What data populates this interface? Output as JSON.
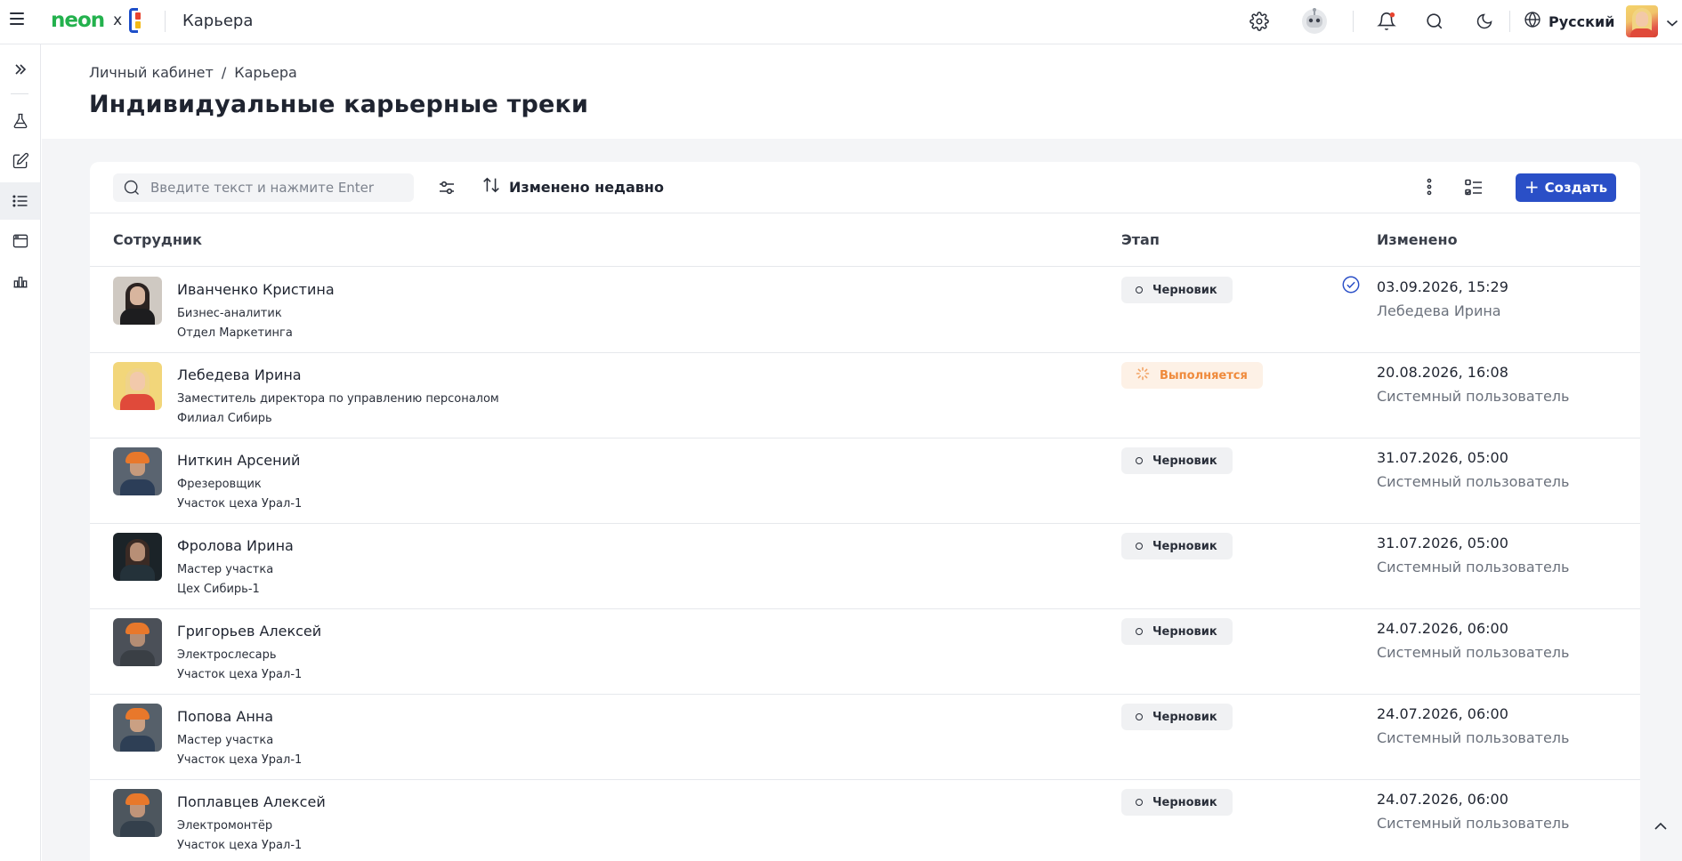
{
  "header": {
    "brand_name": "neon",
    "brand_separator": "x",
    "app_title": "Карьера",
    "language": "Русский",
    "icons": [
      "menu-icon",
      "gear-icon",
      "robot-icon",
      "bell-icon",
      "search-icon",
      "moon-icon",
      "globe-icon",
      "chevron-down-icon"
    ],
    "notification_dot_color": "#e8442f"
  },
  "sidebar": {
    "items": [
      {
        "icon": "double-chevron-right-icon"
      },
      {
        "icon": "flask-icon"
      },
      {
        "icon": "edit-icon"
      },
      {
        "icon": "list-icon",
        "active": true
      },
      {
        "icon": "window-icon"
      },
      {
        "icon": "bar-chart-icon"
      }
    ]
  },
  "page": {
    "breadcrumb": [
      "Личный кабинет",
      "/",
      "Карьера"
    ],
    "title": "Индивидуальные карьерные треки"
  },
  "toolbar": {
    "search_placeholder": "Введите текст и нажмите Enter",
    "sort_label": "Изменено недавно",
    "create_label": "Создать",
    "create_plus": "+",
    "accent_color": "#2a4fc7"
  },
  "table": {
    "columns": [
      "Сотрудник",
      "Этап",
      "Изменено"
    ],
    "rows": [
      {
        "name": "Иванченко Кристина",
        "position": "Бизнес-аналитик",
        "department": "Отдел Маркетинга",
        "stage": "Черновик",
        "changed_at": "03.09.2026, 15:29",
        "changed_by": "Лебедева Ирина",
        "checked": true
      },
      {
        "name": "Лебедева Ирина",
        "position": "Заместитель директора по управлению персоналом",
        "department": "Филиал Сибирь",
        "stage": "Выполняется",
        "changed_at": "20.08.2026, 16:08",
        "changed_by": "Системный пользователь"
      },
      {
        "name": "Ниткин Арсений",
        "position": "Фрезеровщик",
        "department": "Участок цеха Урал-1",
        "stage": "Черновик",
        "changed_at": "31.07.2026, 05:00",
        "changed_by": "Системный пользователь"
      },
      {
        "name": "Фролова Ирина",
        "position": "Мастер участка",
        "department": "Цех Сибирь-1",
        "stage": "Черновик",
        "changed_at": "31.07.2026, 05:00",
        "changed_by": "Системный пользователь"
      },
      {
        "name": "Григорьев Алексей",
        "position": "Электрослесарь",
        "department": "Участок цеха Урал-1",
        "stage": "Черновик",
        "changed_at": "24.07.2026, 06:00",
        "changed_by": "Системный пользователь"
      },
      {
        "name": "Попова Анна",
        "position": "Мастер участка",
        "department": "Участок цеха Урал-1",
        "stage": "Черновик",
        "changed_at": "24.07.2026, 06:00",
        "changed_by": "Системный пользователь"
      },
      {
        "name": "Поплавцев Алексей",
        "position": "Электромонтёр",
        "department": "Участок цеха Урал-1",
        "stage": "Черновик",
        "changed_at": "24.07.2026, 06:00",
        "changed_by": "Системный пользователь"
      }
    ]
  },
  "status_colors": {
    "draft_bg": "#f0f1f3",
    "in_progress_bg": "#fdf1e6",
    "in_progress_text": "#ef8a3c"
  }
}
